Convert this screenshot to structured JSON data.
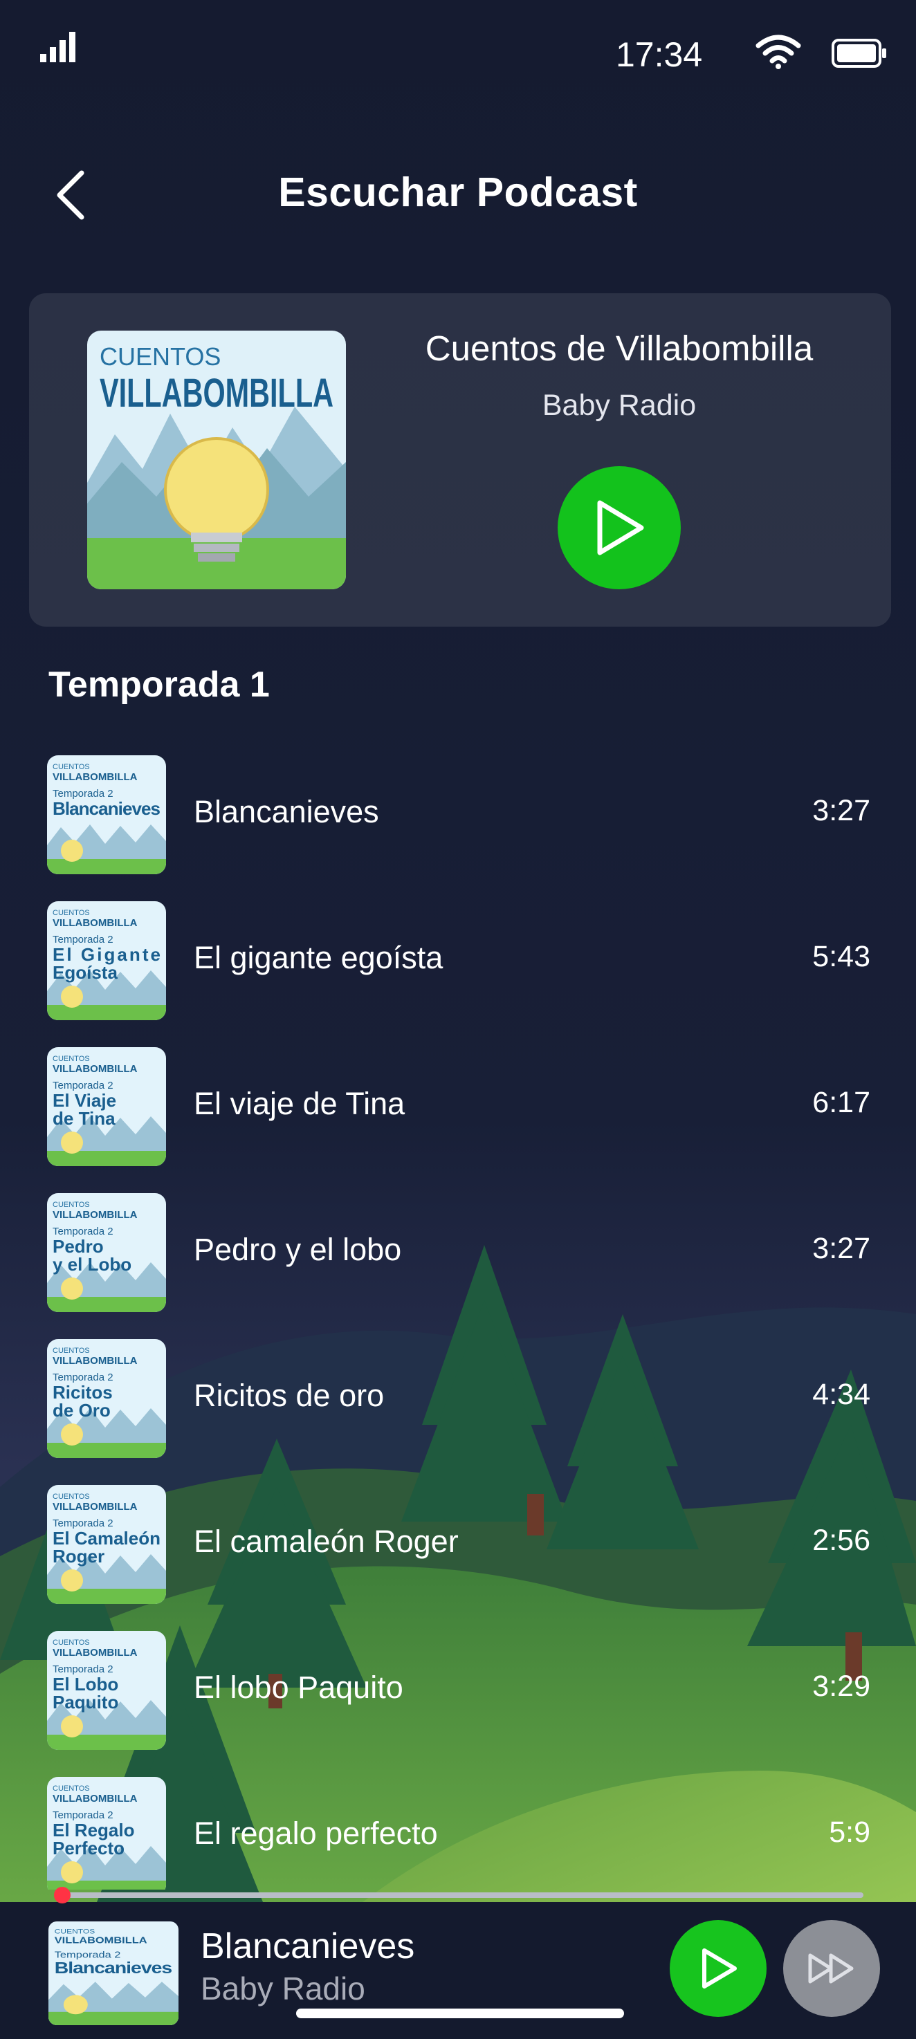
{
  "status_bar": {
    "time": "17:34",
    "icons": [
      "signal-icon",
      "wifi-icon",
      "battery-icon"
    ]
  },
  "header": {
    "title": "Escuchar Podcast",
    "back_icon": "chevron-left-icon"
  },
  "podcast": {
    "title": "Cuentos de Villabombilla",
    "author": "Baby Radio",
    "cover": {
      "line1": "CUENTOS",
      "line2": "VILLABOMBILLA"
    },
    "play_icon": "play-icon"
  },
  "season": {
    "title": "Temporada 1"
  },
  "episodes": [
    {
      "title": "Blancanieves",
      "duration": "3:27",
      "thumb_lines": [
        "Blancanieves",
        ""
      ]
    },
    {
      "title": "El gigante egoísta",
      "duration": "5:43",
      "thumb_lines": [
        "El Gigante",
        "Egoísta"
      ]
    },
    {
      "title": "El viaje de Tina",
      "duration": "6:17",
      "thumb_lines": [
        "El Viaje",
        "de Tina"
      ]
    },
    {
      "title": "Pedro y el lobo",
      "duration": "3:27",
      "thumb_lines": [
        "Pedro",
        "y el Lobo"
      ]
    },
    {
      "title": "Ricitos de oro",
      "duration": "4:34",
      "thumb_lines": [
        "Ricitos",
        "de Oro"
      ]
    },
    {
      "title": "El camaleón Roger",
      "duration": "2:56",
      "thumb_lines": [
        "El Camaleón",
        "Roger"
      ]
    },
    {
      "title": "El lobo Paquito",
      "duration": "3:29",
      "thumb_lines": [
        "El Lobo",
        "Paquito"
      ]
    },
    {
      "title": "El regalo perfecto",
      "duration": "5:9",
      "thumb_lines": [
        "El Regalo",
        "Perfecto"
      ]
    }
  ],
  "thumb_common": {
    "line1": "CUENTOS",
    "line2": "VILLABOMBILLA",
    "line3": "Temporada 2"
  },
  "player": {
    "title": "Blancanieves",
    "author": "Baby Radio",
    "thumb_lines": [
      "Blancanieves",
      ""
    ],
    "progress": 0.0,
    "play_icon": "play-icon",
    "next_icon": "fast-forward-icon"
  },
  "colors": {
    "background": "#141a2e",
    "accent_green": "#13c21c",
    "progress_red": "#ff3344"
  }
}
